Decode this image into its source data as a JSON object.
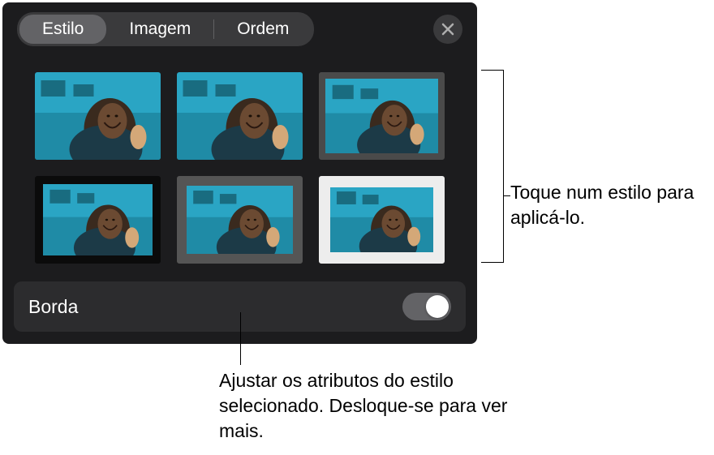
{
  "tabs": {
    "style": "Estilo",
    "image": "Imagem",
    "order": "Ordem"
  },
  "style_options": [
    {
      "variant": "plain"
    },
    {
      "variant": "reflection"
    },
    {
      "variant": "gray-frame"
    },
    {
      "variant": "black-frame"
    },
    {
      "variant": "fat-gray-frame"
    },
    {
      "variant": "white-mat"
    }
  ],
  "border": {
    "label": "Borda",
    "enabled": true
  },
  "callouts": {
    "top": "Toque num estilo para aplicá-lo.",
    "bottom": "Ajustar os atributos do estilo selecionado. Desloque-se para ver mais."
  }
}
